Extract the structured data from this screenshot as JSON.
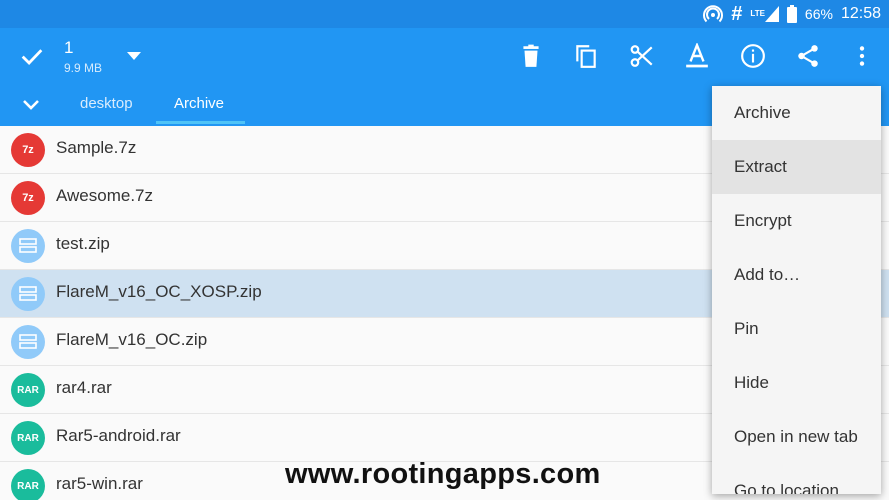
{
  "status_bar": {
    "battery": "66%",
    "time": "12:58",
    "network": "LTE",
    "icons": [
      "hotspot-icon",
      "hash-icon",
      "signal-icon",
      "battery-icon"
    ]
  },
  "toolbar": {
    "selection_count": "1",
    "selection_size": "9.9 MB",
    "icons": [
      "check-icon",
      "dropdown-icon",
      "delete-icon",
      "copy-icon",
      "cut-icon",
      "rename-icon",
      "info-icon",
      "share-icon",
      "more-icon"
    ]
  },
  "tabs": [
    {
      "label": "desktop",
      "active": false
    },
    {
      "label": "Archive",
      "active": true
    }
  ],
  "files": [
    {
      "name": "Sample.7z",
      "type_label": "7z",
      "kind": "z7",
      "selected": false
    },
    {
      "name": "Awesome.7z",
      "type_label": "7z",
      "kind": "z7",
      "selected": false
    },
    {
      "name": "test.zip",
      "type_label": "",
      "kind": "zip",
      "selected": false
    },
    {
      "name": "FlareM_v16_OC_XOSP.zip",
      "type_label": "",
      "kind": "zip",
      "selected": true
    },
    {
      "name": "FlareM_v16_OC.zip",
      "type_label": "",
      "kind": "zip",
      "selected": false
    },
    {
      "name": "rar4.rar",
      "type_label": "RAR",
      "kind": "rar",
      "selected": false
    },
    {
      "name": "Rar5-android.rar",
      "type_label": "RAR",
      "kind": "rar",
      "selected": false
    },
    {
      "name": "rar5-win.rar",
      "type_label": "RAR",
      "kind": "rar",
      "selected": false
    }
  ],
  "context_menu": {
    "items": [
      "Archive",
      "Extract",
      "Encrypt",
      "Add to…",
      "Pin",
      "Hide",
      "Open in new tab",
      "Go to location"
    ],
    "highlighted": "Extract"
  },
  "watermark": "www.rootingapps.com",
  "colors": {
    "status_bar": "#1e88e5",
    "app_bar": "#2196f3",
    "tab_indicator": "#4fc3f7",
    "selected_row": "#cfe1f1",
    "badge_7z": "#e53935",
    "badge_zip": "#90caf9",
    "badge_rar": "#1abc9c"
  }
}
